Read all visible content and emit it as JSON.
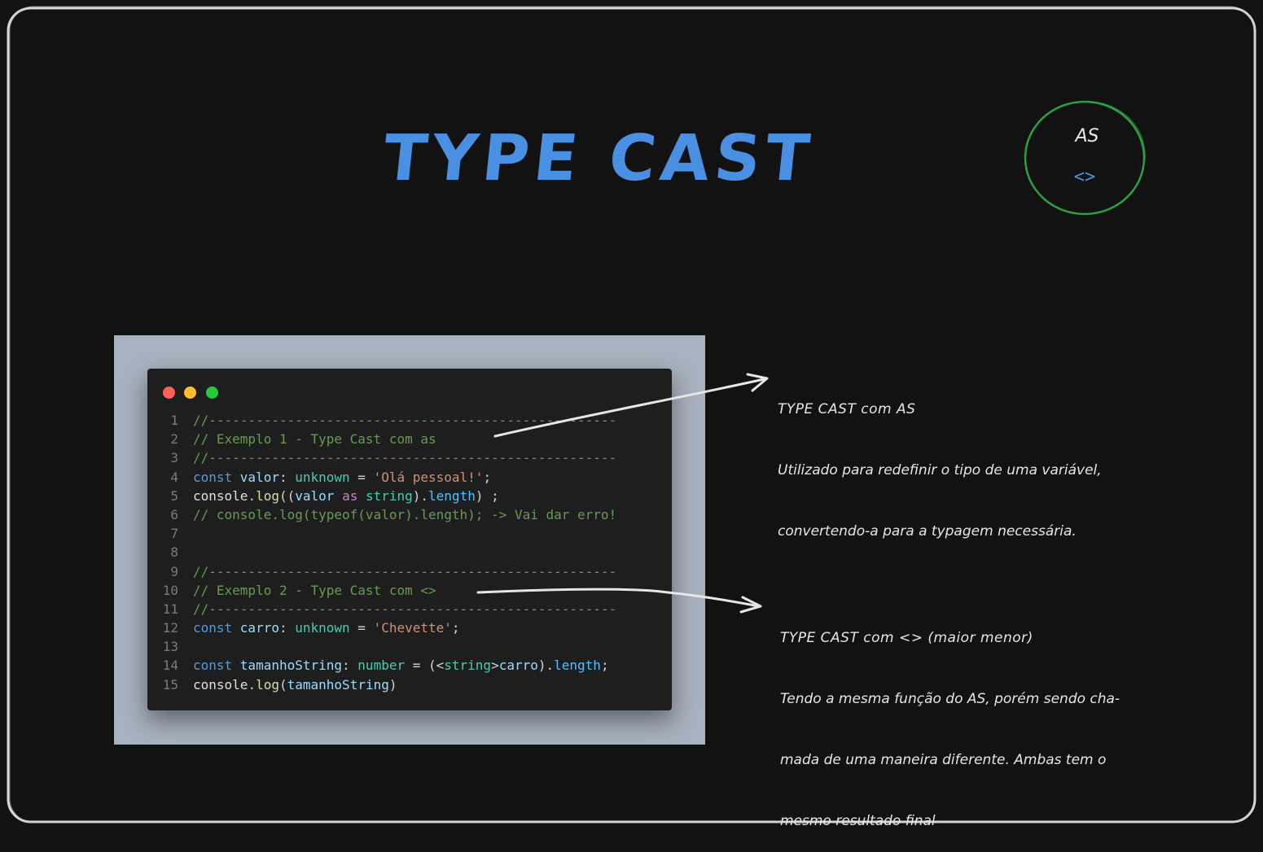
{
  "title": "TYPE CAST",
  "circle": {
    "label_top": "AS",
    "label_bottom": "<>",
    "color": "#2e9e44"
  },
  "window_controls": [
    "close",
    "minimize",
    "maximize"
  ],
  "code_lines": [
    {
      "n": "1",
      "tokens": [
        {
          "c": "comment",
          "t": "//----------------------------------------------------"
        }
      ]
    },
    {
      "n": "2",
      "tokens": [
        {
          "c": "comment",
          "t": "// Exemplo 1 - Type Cast com as"
        }
      ]
    },
    {
      "n": "3",
      "tokens": [
        {
          "c": "comment",
          "t": "//----------------------------------------------------"
        }
      ]
    },
    {
      "n": "4",
      "tokens": [
        {
          "c": "keyword",
          "t": "const "
        },
        {
          "c": "var",
          "t": "valor"
        },
        {
          "c": "punc",
          "t": ": "
        },
        {
          "c": "type",
          "t": "unknown"
        },
        {
          "c": "punc",
          "t": " = "
        },
        {
          "c": "string",
          "t": "'Olá pessoal!'"
        },
        {
          "c": "punc",
          "t": ";"
        }
      ]
    },
    {
      "n": "5",
      "tokens": [
        {
          "c": "plain",
          "t": "console"
        },
        {
          "c": "punc",
          "t": "."
        },
        {
          "c": "fn",
          "t": "log"
        },
        {
          "c": "punc",
          "t": "(("
        },
        {
          "c": "var",
          "t": "valor"
        },
        {
          "c": "punc",
          "t": " "
        },
        {
          "c": "as",
          "t": "as"
        },
        {
          "c": "punc",
          "t": " "
        },
        {
          "c": "type",
          "t": "string"
        },
        {
          "c": "punc",
          "t": ")."
        },
        {
          "c": "prop",
          "t": "length"
        },
        {
          "c": "punc",
          "t": ") ;"
        }
      ]
    },
    {
      "n": "6",
      "tokens": [
        {
          "c": "comment",
          "t": "// console.log(typeof(valor).length); -> Vai dar erro!"
        }
      ]
    },
    {
      "n": "7",
      "tokens": []
    },
    {
      "n": "8",
      "tokens": []
    },
    {
      "n": "9",
      "tokens": [
        {
          "c": "comment",
          "t": "//----------------------------------------------------"
        }
      ]
    },
    {
      "n": "10",
      "tokens": [
        {
          "c": "comment",
          "t": "// Exemplo 2 - Type Cast com <>"
        }
      ]
    },
    {
      "n": "11",
      "tokens": [
        {
          "c": "comment",
          "t": "//----------------------------------------------------"
        }
      ]
    },
    {
      "n": "12",
      "tokens": [
        {
          "c": "keyword",
          "t": "const "
        },
        {
          "c": "var",
          "t": "carro"
        },
        {
          "c": "punc",
          "t": ": "
        },
        {
          "c": "type",
          "t": "unknown"
        },
        {
          "c": "punc",
          "t": " = "
        },
        {
          "c": "string",
          "t": "'Chevette'"
        },
        {
          "c": "punc",
          "t": ";"
        }
      ]
    },
    {
      "n": "13",
      "tokens": []
    },
    {
      "n": "14",
      "tokens": [
        {
          "c": "keyword",
          "t": "const "
        },
        {
          "c": "var",
          "t": "tamanhoString"
        },
        {
          "c": "punc",
          "t": ": "
        },
        {
          "c": "type",
          "t": "number"
        },
        {
          "c": "punc",
          "t": " = (<"
        },
        {
          "c": "type",
          "t": "string"
        },
        {
          "c": "punc",
          "t": ">"
        },
        {
          "c": "var",
          "t": "carro"
        },
        {
          "c": "punc",
          "t": ")."
        },
        {
          "c": "prop",
          "t": "length"
        },
        {
          "c": "punc",
          "t": ";"
        }
      ]
    },
    {
      "n": "15",
      "tokens": [
        {
          "c": "plain",
          "t": "console"
        },
        {
          "c": "punc",
          "t": "."
        },
        {
          "c": "fn",
          "t": "log"
        },
        {
          "c": "punc",
          "t": "("
        },
        {
          "c": "var",
          "t": "tamanhoString"
        },
        {
          "c": "punc",
          "t": ")"
        }
      ]
    }
  ],
  "note_as": {
    "title": "TYPE CAST com AS",
    "lines": [
      "Utilizado para redefinir o tipo de uma variável,",
      "convertendo-a para a typagem necessária."
    ]
  },
  "note_angle": {
    "title": "TYPE CAST com <> (maior menor)",
    "lines": [
      "Tendo a mesma função do AS, porém sendo cha-",
      "mada de uma maneira diferente. Ambas tem o",
      "mesmo resultado final"
    ]
  },
  "colors": {
    "background": "#121212",
    "title": "#4a90e2",
    "circle": "#2e9e44",
    "code_backdrop": "#a8b2be",
    "code_window": "#1e1e1e"
  }
}
